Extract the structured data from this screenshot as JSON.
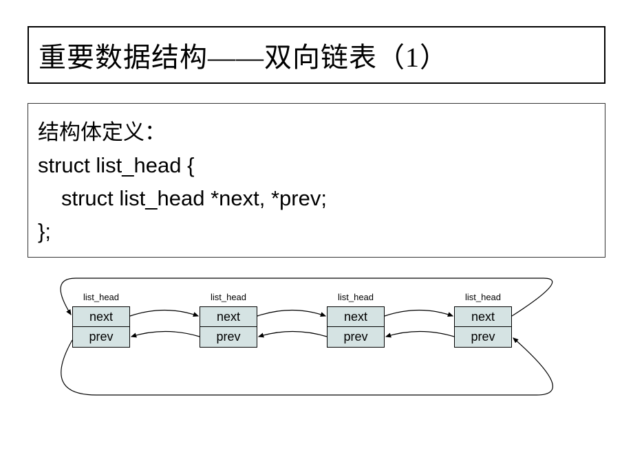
{
  "title": "重要数据结构——双向链表（1）",
  "content": {
    "heading": "结构体定义：",
    "code_line1": "struct list_head {",
    "code_line2": "struct list_head *next, *prev;",
    "code_line3": "};"
  },
  "diagram": {
    "node_label": "list_head",
    "field_next": "next",
    "field_prev": "prev",
    "node_count": 4
  }
}
